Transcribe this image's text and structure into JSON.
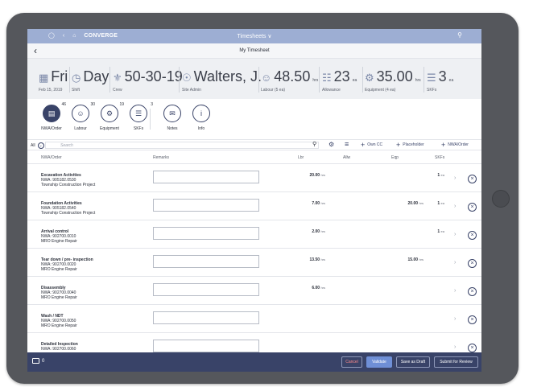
{
  "appbar": {
    "brand": "CONVERGE",
    "title": "Timesheets",
    "title_chevron": "∨"
  },
  "subbar": {
    "back": "‹",
    "title": "My Timesheet"
  },
  "summary": {
    "date": {
      "value": "Fri",
      "sub": "Feb 15, 2019"
    },
    "shift": {
      "value": "Day",
      "sub": "Shift"
    },
    "crew": {
      "value": "50-30-19",
      "sub": "Crew"
    },
    "person": {
      "value": "Walters, J.",
      "sub": "Site Admin"
    },
    "labour": {
      "value": "48.50",
      "unit": "hrs",
      "sub": "Labour (5 ea)"
    },
    "allowance": {
      "value": "23",
      "unit": "ea",
      "sub": "Allowance"
    },
    "equipment": {
      "value": "35.00",
      "unit": "hrs",
      "sub": "Equipment (4 ea)"
    },
    "skfs": {
      "value": "3",
      "unit": "ea",
      "sub": "SKFs"
    }
  },
  "tabs": [
    {
      "label": "NWA/Order",
      "badge": "46",
      "icon": "clipboard-icon"
    },
    {
      "label": "Labour",
      "badge": "30",
      "icon": "people-icon"
    },
    {
      "label": "Equipment",
      "badge": "19",
      "icon": "equipment-icon"
    },
    {
      "label": "SKFs",
      "badge": "3",
      "icon": "skf-icon"
    },
    {
      "label": "Notes",
      "badge": "",
      "icon": "notes-icon"
    },
    {
      "label": "Info",
      "badge": "",
      "icon": "info-icon"
    }
  ],
  "filter": {
    "all_label": "All",
    "search_placeholder": "Search",
    "own_cc": "Own CC",
    "placeholder": "Placeholder",
    "nwa_order": "NWA/Order"
  },
  "table": {
    "headers": {
      "nwa": "NWA/Order",
      "remarks": "Remarks",
      "lbr": "Lbr",
      "allw": "Allw",
      "eqp": "Eqp",
      "skfs": "SKFs"
    },
    "rows": [
      {
        "title": "Excavation Activities",
        "nwa": "NWA: 905182.0530",
        "project": "Township Construction Project",
        "lbr": "20.00",
        "lbr_unit": "hrs",
        "eqp": "",
        "eqp_unit": "",
        "skfs": "1",
        "skfs_unit": "ea"
      },
      {
        "title": "Foundation Activities",
        "nwa": "NWA: 905182.0540",
        "project": "Township Construction Project",
        "lbr": "7.00",
        "lbr_unit": "hrs",
        "eqp": "20.00",
        "eqp_unit": "hrs",
        "skfs": "1",
        "skfs_unit": "ea"
      },
      {
        "title": "Arrival control",
        "nwa": "NWA: 902700.0010",
        "project": "MRO Engine Repair",
        "lbr": "2.00",
        "lbr_unit": "hrs",
        "eqp": "",
        "eqp_unit": "",
        "skfs": "1",
        "skfs_unit": "ea"
      },
      {
        "title": "Tear down / pre- inspection",
        "nwa": "NWA: 902700.0020",
        "project": "MRO Engine Repair",
        "lbr": "13.50",
        "lbr_unit": "hrs",
        "eqp": "15.00",
        "eqp_unit": "hrs",
        "skfs": "",
        "skfs_unit": ""
      },
      {
        "title": "Disassembly",
        "nwa": "NWA: 902700.0040",
        "project": "MRO Engine Repair",
        "lbr": "6.00",
        "lbr_unit": "hrs",
        "eqp": "",
        "eqp_unit": "",
        "skfs": "",
        "skfs_unit": ""
      },
      {
        "title": "Wash / NDT",
        "nwa": "NWA: 902700.0050",
        "project": "MRO Engine Repair",
        "lbr": "",
        "lbr_unit": "",
        "eqp": "",
        "eqp_unit": "",
        "skfs": "",
        "skfs_unit": ""
      },
      {
        "title": "Detailed Inspection",
        "nwa": "NWA: 902700.0060",
        "project": "",
        "lbr": "",
        "lbr_unit": "",
        "eqp": "",
        "eqp_unit": "",
        "skfs": "",
        "skfs_unit": ""
      }
    ]
  },
  "footer": {
    "count": "0",
    "cancel": "Cancel",
    "validate": "Validate",
    "save_draft": "Save as Draft",
    "submit": "Submit for Review"
  },
  "colors": {
    "accent": "#394368",
    "appbar": "#9daed3",
    "summary_bg": "#eef0f3",
    "cancel_text": "#ff8a8a",
    "validate_bg": "#6f8fd6"
  }
}
